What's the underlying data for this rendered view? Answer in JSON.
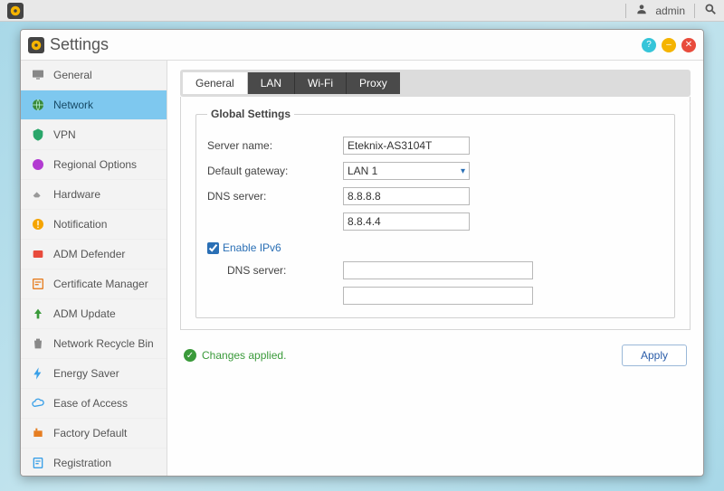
{
  "taskbar": {
    "user_label": "admin"
  },
  "window": {
    "title": "Settings"
  },
  "sidebar": {
    "items": [
      {
        "label": "General"
      },
      {
        "label": "Network"
      },
      {
        "label": "VPN"
      },
      {
        "label": "Regional Options"
      },
      {
        "label": "Hardware"
      },
      {
        "label": "Notification"
      },
      {
        "label": "ADM Defender"
      },
      {
        "label": "Certificate Manager"
      },
      {
        "label": "ADM Update"
      },
      {
        "label": "Network Recycle Bin"
      },
      {
        "label": "Energy Saver"
      },
      {
        "label": "Ease of Access"
      },
      {
        "label": "Factory Default"
      },
      {
        "label": "Registration"
      }
    ]
  },
  "tabs": [
    {
      "label": "General"
    },
    {
      "label": "LAN"
    },
    {
      "label": "Wi-Fi"
    },
    {
      "label": "Proxy"
    }
  ],
  "form": {
    "group_title": "Global Settings",
    "server_name_label": "Server name:",
    "server_name_value": "Eteknix-AS3104T",
    "default_gateway_label": "Default gateway:",
    "default_gateway_value": "LAN 1",
    "dns_label": "DNS server:",
    "dns1_value": "8.8.8.8",
    "dns2_value": "8.8.4.4",
    "ipv6_checkbox_label": "Enable IPv6",
    "ipv6_dns_label": "DNS server:",
    "ipv6_dns1_value": "",
    "ipv6_dns2_value": ""
  },
  "footer": {
    "status_text": "Changes applied.",
    "apply_label": "Apply"
  }
}
